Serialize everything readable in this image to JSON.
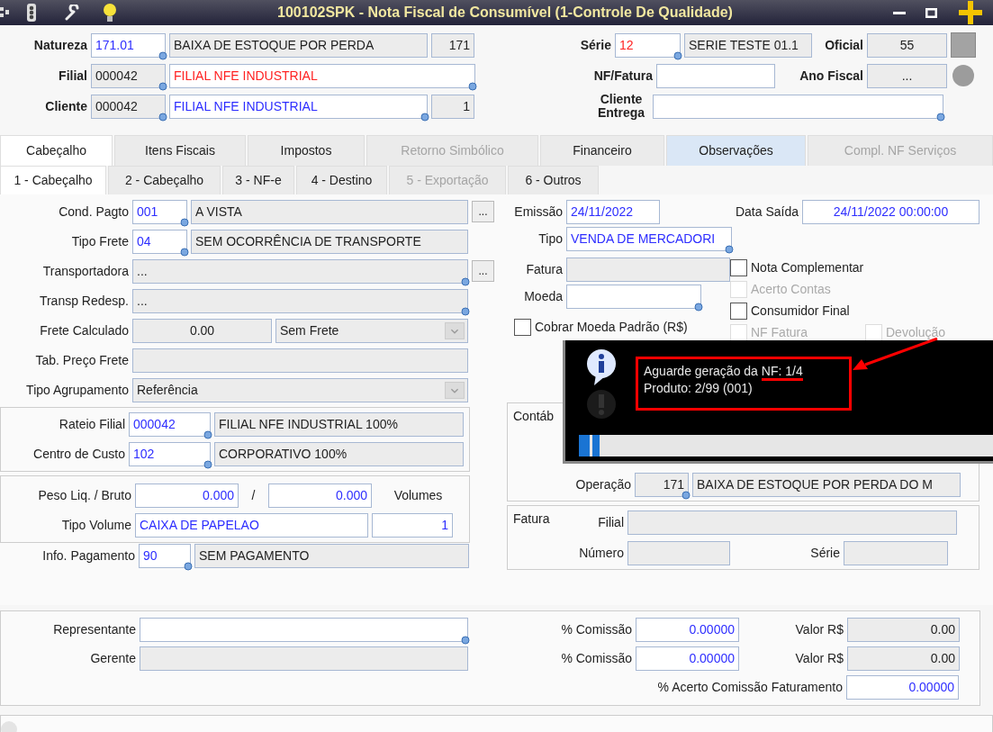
{
  "title_bar": {
    "title": "100102SPK - Nota Fiscal de Consumível (1-Controle De Qualidade)"
  },
  "header": {
    "left": [
      [
        {
          "kind": "label",
          "text": "Natureza"
        },
        {
          "kind": "edit",
          "value": "171.01",
          "lookup": true
        },
        {
          "kind": "readonly",
          "value": "BAIXA DE ESTOQUE POR PERDA"
        },
        {
          "kind": "readonly",
          "value": "171",
          "right": true
        }
      ],
      [
        {
          "kind": "label",
          "text": "Filial"
        },
        {
          "kind": "readonly",
          "value": "000042",
          "lookup": true
        },
        {
          "kind": "alert",
          "value": "FILIAL NFE INDUSTRIAL",
          "lookup": true
        }
      ],
      [
        {
          "kind": "label",
          "text": "Cliente"
        },
        {
          "kind": "readonly",
          "value": "000042",
          "lookup": true
        },
        {
          "kind": "edit",
          "value": "FILIAL NFE INDUSTRIAL",
          "lookup": true
        },
        {
          "kind": "readonly",
          "value": "1",
          "right": true
        }
      ]
    ],
    "right": [
      [
        {
          "kind": "label",
          "text": "Série"
        },
        {
          "kind": "alert",
          "value": "12",
          "lookup": true
        },
        {
          "kind": "readonly",
          "value": "SERIE TESTE 01.1"
        },
        {
          "kind": "label",
          "text": "Oficial"
        },
        {
          "kind": "readonly",
          "value": "55",
          "centered": true
        },
        {
          "kind": "square"
        }
      ],
      [
        {
          "kind": "label",
          "text": "NF/Fatura"
        },
        {
          "kind": "edit"
        },
        {
          "kind": "label",
          "text": "Ano Fiscal"
        },
        {
          "kind": "readonly",
          "value": "...",
          "centered": true
        },
        {
          "kind": "blob"
        }
      ],
      [
        {
          "kind": "label",
          "text": "Cliente Entrega"
        },
        {
          "kind": "edit",
          "lookup": true
        }
      ]
    ]
  },
  "main_tabs": [
    {
      "label": "Cabeçalho",
      "selected": true,
      "disabled": false
    },
    {
      "label": "Itens Fiscais",
      "selected": false,
      "disabled": false
    },
    {
      "label": "Impostos",
      "selected": false,
      "disabled": false
    },
    {
      "label": "Retorno Simbólico",
      "selected": false,
      "disabled": true
    },
    {
      "label": "Financeiro",
      "selected": false,
      "disabled": false
    },
    {
      "label": "Observações",
      "selected": false,
      "disabled": false,
      "highlighted": true
    },
    {
      "label": "Compl. NF Serviços",
      "selected": false,
      "disabled": true
    }
  ],
  "sub_tabs": [
    {
      "label": "1 - Cabeçalho",
      "selected": true,
      "disabled": false
    },
    {
      "label": "2 - Cabeçalho",
      "selected": false,
      "disabled": false
    },
    {
      "label": "3 - NF-e",
      "selected": false,
      "disabled": false
    },
    {
      "label": "4 - Destino",
      "selected": false,
      "disabled": false
    },
    {
      "label": "5 - Exportação",
      "selected": false,
      "disabled": true
    },
    {
      "label": "6 - Outros",
      "selected": false,
      "disabled": false
    }
  ],
  "left": {
    "rows": [
      {
        "label": "Cond. Pagto",
        "fields": [
          {
            "kind": "edit",
            "value": "001",
            "lookup": true
          },
          {
            "kind": "readonly",
            "value": "A VISTA"
          }
        ],
        "button": "..."
      },
      {
        "label": "Tipo Frete",
        "fields": [
          {
            "kind": "edit",
            "value": "04",
            "lookup": true
          },
          {
            "kind": "readonly",
            "value": "SEM OCORRÊNCIA DE TRANSPORTE"
          }
        ]
      },
      {
        "label": "Transportadora",
        "fields": [
          {
            "kind": "readonly",
            "value": "...",
            "lookup": true
          }
        ],
        "button": "..."
      },
      {
        "label": "Transp Redesp.",
        "fields": [
          {
            "kind": "readonly",
            "value": "...",
            "lookup": true
          }
        ]
      },
      {
        "label": "Frete Calculado",
        "fields": [
          {
            "kind": "readonly",
            "value": "0.00",
            "centered": true
          },
          {
            "kind": "readonly",
            "value": "Sem Frete",
            "dropdown": true
          }
        ]
      },
      {
        "label": "Tab. Preço Frete",
        "fields": [
          {
            "kind": "readonly"
          }
        ]
      },
      {
        "label": "Tipo Agrupamento",
        "fields": [
          {
            "kind": "readonly",
            "value": "Referência",
            "dropdown": true
          }
        ]
      }
    ],
    "rateio": [
      [
        {
          "kind": "label",
          "text": "Rateio  Filial"
        },
        {
          "kind": "edit",
          "value": "000042",
          "lookup": true
        },
        {
          "kind": "readonly",
          "value": "FILIAL NFE INDUSTRIAL 100%"
        }
      ],
      [
        {
          "kind": "label",
          "text": "Centro de Custo"
        },
        {
          "kind": "edit",
          "value": "102",
          "lookup": true
        },
        {
          "kind": "readonly",
          "value": "CORPORATIVO 100%"
        }
      ]
    ],
    "volumes": [
      [
        {
          "kind": "label",
          "text": "Peso Liq. / Bruto"
        },
        {
          "kind": "edit",
          "value": "0.000",
          "right": true
        },
        {
          "kind": "label",
          "text": "/"
        },
        {
          "kind": "edit",
          "value": "0.000",
          "right": true
        },
        {
          "kind": "label",
          "text": "Volumes"
        }
      ],
      [
        {
          "kind": "label",
          "text": "Tipo Volume"
        },
        {
          "kind": "edit",
          "value": "CAIXA DE PAPELAO"
        },
        {
          "kind": "edit",
          "value": "1",
          "right": true
        }
      ]
    ],
    "payment": [
      [
        {
          "kind": "label",
          "text": "Info. Pagamento"
        },
        {
          "kind": "edit",
          "value": "90",
          "lookup": true
        },
        {
          "kind": "readonly",
          "value": "SEM PAGAMENTO"
        }
      ]
    ]
  },
  "right": {
    "top": [
      [
        {
          "kind": "label",
          "text": "Emissão"
        },
        {
          "kind": "edit",
          "value": "24/11/2022"
        },
        {
          "kind": "label",
          "text": "Data Saída"
        },
        {
          "kind": "edit",
          "value": "24/11/2022 00:00:00",
          "centered": true
        }
      ],
      [
        {
          "kind": "label",
          "text": "Tipo"
        },
        {
          "kind": "edit",
          "value": "VENDA DE MERCADORI",
          "lookup": true
        }
      ]
    ],
    "fields": [
      [
        {
          "kind": "label",
          "text": "Fatura"
        },
        {
          "kind": "readonly"
        }
      ],
      [
        {
          "kind": "label",
          "text": "Moeda"
        },
        {
          "kind": "edit",
          "lookup": true
        }
      ],
      [
        {
          "kind": "checkbox",
          "text": "Cobrar Moeda Padrão (R$)",
          "checked": false,
          "disabled": false
        }
      ]
    ],
    "checkboxes": [
      {
        "kind": "checkbox",
        "text": "Nota Complementar",
        "checked": false,
        "disabled": false
      },
      {
        "kind": "checkbox",
        "text": "Acerto Contas",
        "checked": false,
        "disabled": true
      },
      {
        "kind": "checkbox",
        "text": "Consumidor Final",
        "checked": false,
        "disabled": false
      },
      {
        "kind": "checkbox",
        "text": "NF Fatura",
        "checked": false,
        "disabled": true
      },
      {
        "kind": "checkbox",
        "text": "Devolução",
        "checked": false,
        "disabled": true
      }
    ],
    "contabil": {
      "title": "Contáb",
      "rows": [
        [
          {
            "kind": "label",
            "text": "Operação"
          },
          {
            "kind": "readonly",
            "value": "171",
            "right": true,
            "lookup": true
          },
          {
            "kind": "readonly",
            "value": "BAIXA DE ESTOQUE POR PERDA DO M"
          }
        ]
      ]
    },
    "invoice": {
      "title": "Fatura",
      "rows": [
        [
          {
            "kind": "label",
            "text": "Filial"
          },
          {
            "kind": "readonly"
          }
        ],
        [
          {
            "kind": "label",
            "text": "Número"
          },
          {
            "kind": "readonly"
          },
          {
            "kind": "label",
            "text": "Série"
          },
          {
            "kind": "readonly"
          }
        ]
      ]
    }
  },
  "bottom": [
    [
      {
        "kind": "label",
        "text": "Representante"
      },
      {
        "kind": "edit",
        "lookup": true
      },
      {
        "kind": "label",
        "text": "% Comissão"
      },
      {
        "kind": "edit",
        "value": "0.00000",
        "right": true
      },
      {
        "kind": "label",
        "text": "Valor R$"
      },
      {
        "kind": "readonly",
        "value": "0.00",
        "right": true
      }
    ],
    [
      {
        "kind": "label",
        "text": "Gerente"
      },
      {
        "kind": "readonly"
      },
      {
        "kind": "label",
        "text": "% Comissão"
      },
      {
        "kind": "edit",
        "value": "0.00000",
        "right": true
      },
      {
        "kind": "label",
        "text": "Valor R$"
      },
      {
        "kind": "readonly",
        "value": "0.00",
        "right": true
      }
    ],
    [
      {
        "kind": "label",
        "text": "% Acerto Comissão Faturamento"
      },
      {
        "kind": "edit",
        "value": "0.00000",
        "right": true
      }
    ]
  ],
  "progress_dialog": {
    "lines": [
      {
        "text": "Aguarde geração da",
        "marked": "NF: 1/4"
      },
      {
        "text": "Produto: 2/99 (001)"
      }
    ],
    "level": 0.05
  }
}
